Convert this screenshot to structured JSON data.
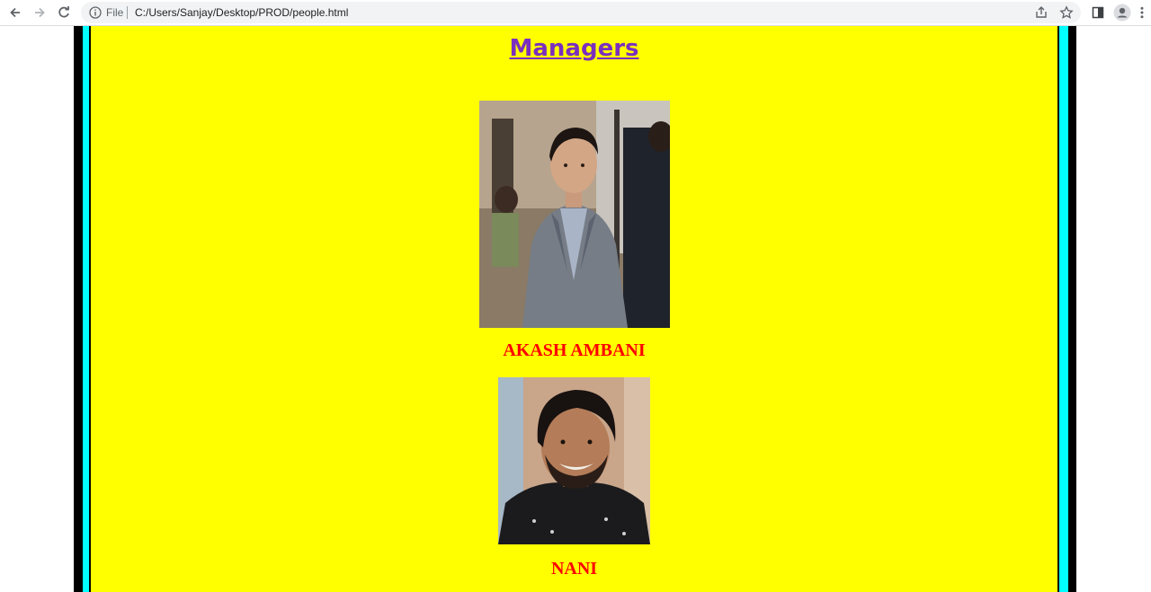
{
  "browser": {
    "file_label": "File",
    "url": "C:/Users/Sanjay/Desktop/PROD/people.html",
    "icons": [
      "back-icon",
      "forward-icon",
      "reload-icon",
      "info-icon",
      "share-icon",
      "star-icon",
      "side-panel-icon",
      "profile-icon",
      "menu-icon"
    ]
  },
  "page": {
    "heading": "Managers",
    "people": [
      {
        "name": "AKASH AMBANI"
      },
      {
        "name": "NANI"
      }
    ]
  },
  "colors": {
    "background": "#ffff00",
    "heading": "#7b2fbe",
    "name": "#ff0000",
    "border_outer": "#000000",
    "border_inner": "#00ffff"
  }
}
